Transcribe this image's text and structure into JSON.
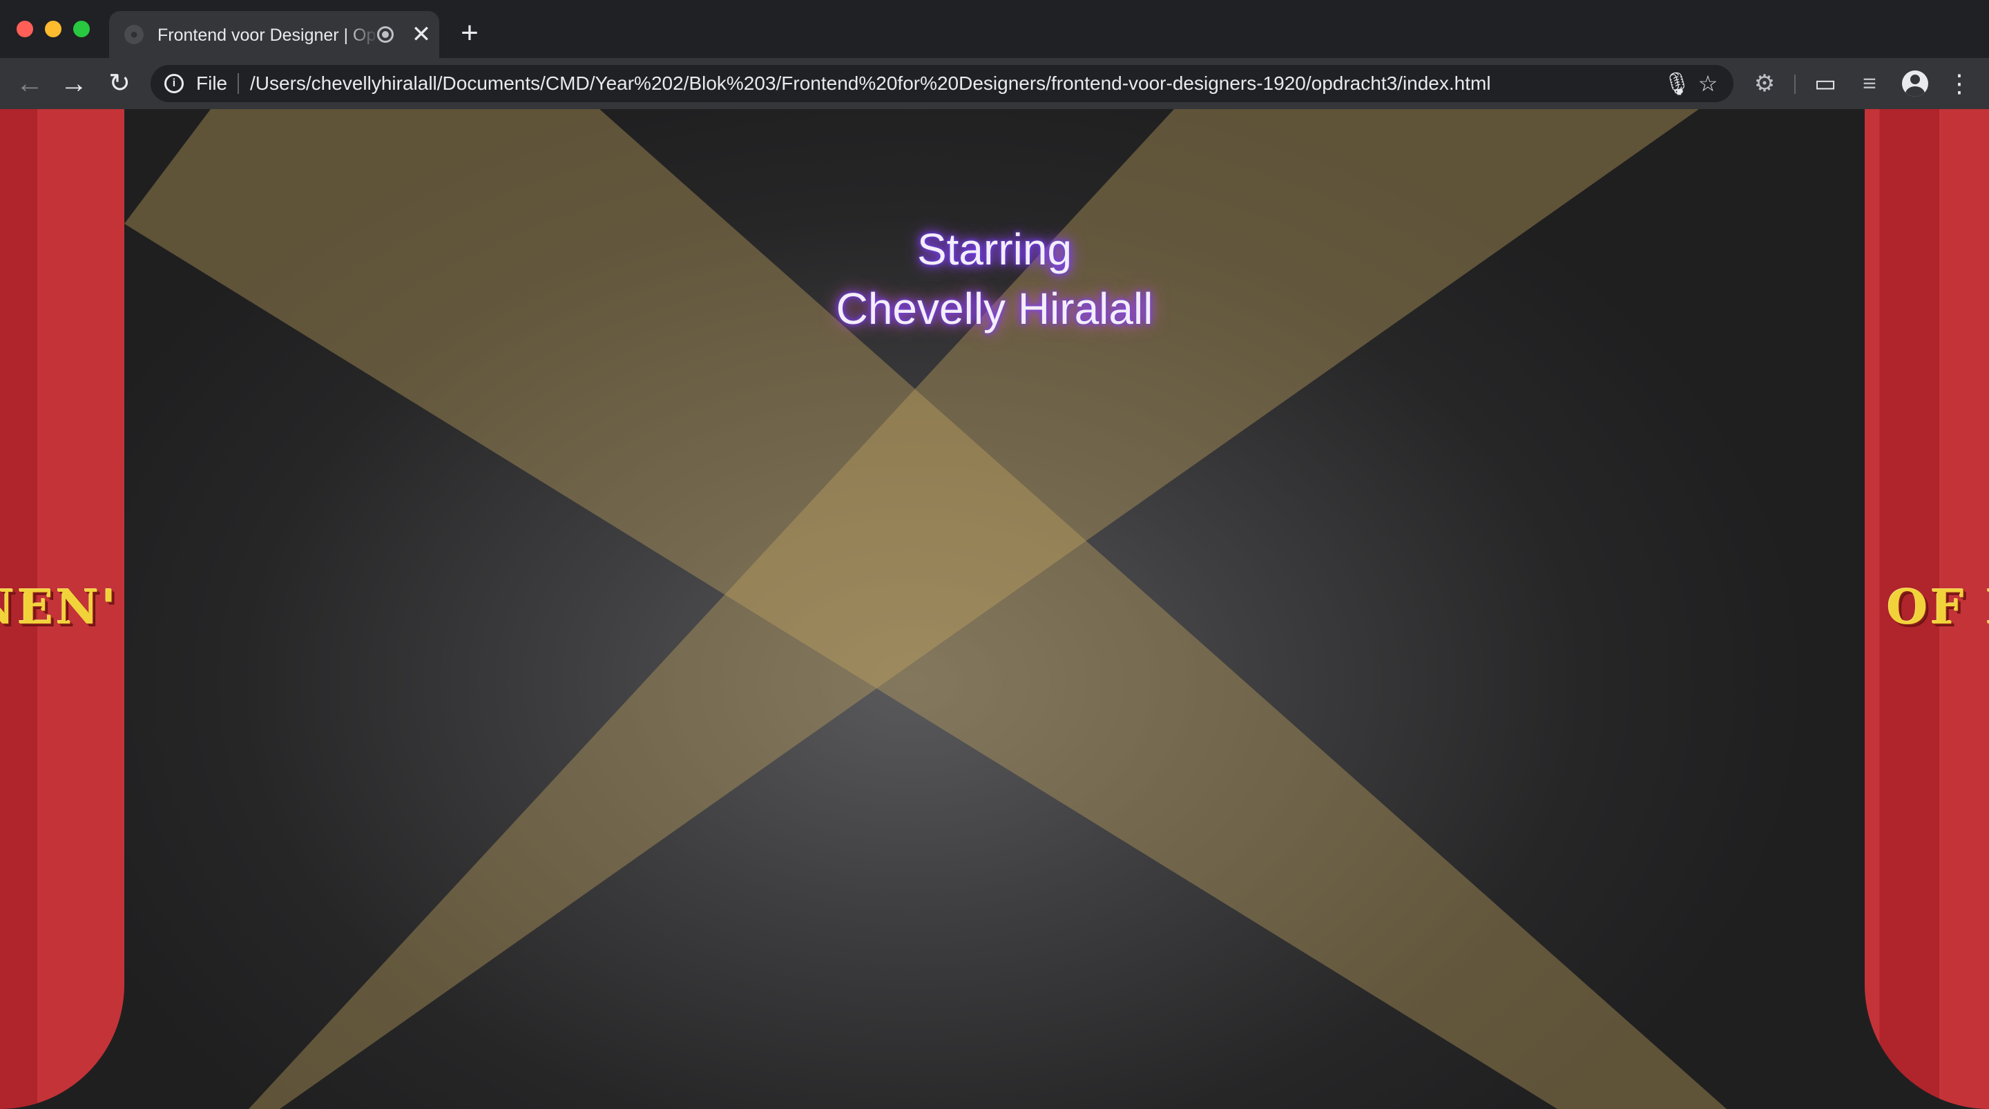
{
  "window": {
    "controls": [
      "close",
      "minimize",
      "maximize"
    ]
  },
  "tab": {
    "title": "Frontend voor Designer | Op",
    "favicon": "globe-icon",
    "audio_icon": "audio-playing-icon",
    "close_glyph": "✕"
  },
  "new_tab_glyph": "+",
  "toolbar": {
    "back_glyph": "←",
    "forward_glyph": "→",
    "reload_glyph": "↻",
    "info_glyph": "i",
    "scheme": "File",
    "url": "/Users/chevellyhiralall/Documents/CMD/Year%202/Blok%203/Frontend%20for%20Designers/frontend-voor-designers-1920/opdracht3/index.html",
    "mic_glyph": "🎙",
    "star_glyph": "☆",
    "extension_glyph": "⚙",
    "cast_glyph": "▭",
    "media_glyph": "≡",
    "menu_glyph": "⋮"
  },
  "page": {
    "starring_label": "Starring",
    "star_name": "Chevelly Hiralall",
    "left_curtain_text": "NEN'",
    "right_curtain_text": "OF I",
    "colors": {
      "curtain_red": "#c43338",
      "curtain_dark_red": "#b0242b",
      "marquee_yellow": "#f2d23a",
      "spotlight": "#c8a860",
      "glow_purple": "#7b3cff",
      "glow_pink": "#ff6fb0"
    }
  }
}
